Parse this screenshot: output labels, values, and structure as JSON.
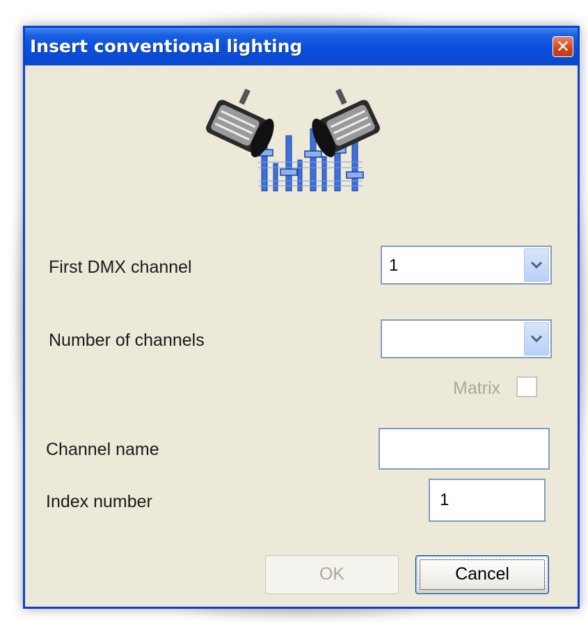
{
  "window": {
    "title": "Insert conventional lighting",
    "close_symbol": "✕"
  },
  "logo": {
    "icon": "stage-lights-mixer-icon"
  },
  "form": {
    "first_dmx": {
      "label": "First DMX channel",
      "value": "1"
    },
    "num_channels": {
      "label": "Number of channels",
      "value": ""
    },
    "matrix": {
      "label": "Matrix",
      "checked": false
    },
    "channel_name": {
      "label": "Channel name",
      "value": ""
    },
    "index_number": {
      "label": "Index number",
      "value": "1"
    }
  },
  "buttons": {
    "ok": "OK",
    "cancel": "Cancel"
  },
  "colors": {
    "title_bar": "#0a4fdc",
    "window_bg": "#ece9d8",
    "field_border": "#7f9db9",
    "disabled_text": "#aca899"
  }
}
